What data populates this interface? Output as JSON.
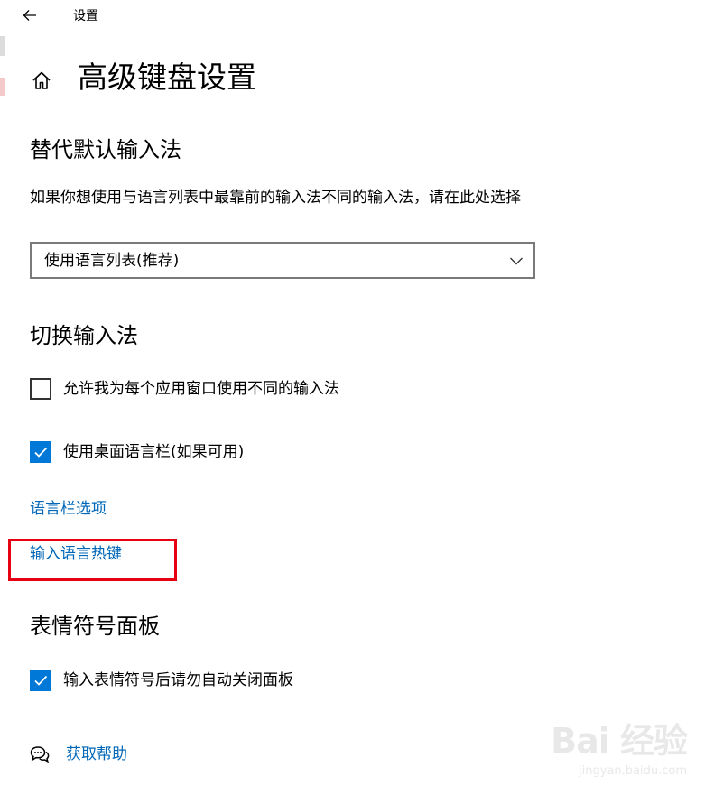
{
  "window": {
    "title": "设置"
  },
  "page": {
    "title": "高级键盘设置"
  },
  "override_input": {
    "heading": "替代默认输入法",
    "description": "如果你想使用与语言列表中最靠前的输入法不同的输入法，请在此处选择",
    "dropdown_value": "使用语言列表(推荐)"
  },
  "switch_input": {
    "heading": "切换输入法",
    "option_per_app": {
      "label": "允许我为每个应用窗口使用不同的输入法",
      "checked": false
    },
    "option_desktop_bar": {
      "label": "使用桌面语言栏(如果可用)",
      "checked": true
    },
    "link_language_bar": "语言栏选项",
    "link_hotkeys": "输入语言热键"
  },
  "emoji_panel": {
    "heading": "表情符号面板",
    "option_auto_close": {
      "label": "输入表情符号后请勿自动关闭面板",
      "checked": true
    }
  },
  "help": {
    "label": "获取帮助"
  },
  "watermark": {
    "main": "Bai 经验",
    "url": "jingyan.baidu.com"
  },
  "colors": {
    "accent": "#0078d7",
    "link": "#0067b8",
    "highlight": "#e60012"
  },
  "icons": [
    "back-arrow-icon",
    "home-icon",
    "chevron-down-icon",
    "checkmark-icon",
    "help-chat-icon"
  ]
}
